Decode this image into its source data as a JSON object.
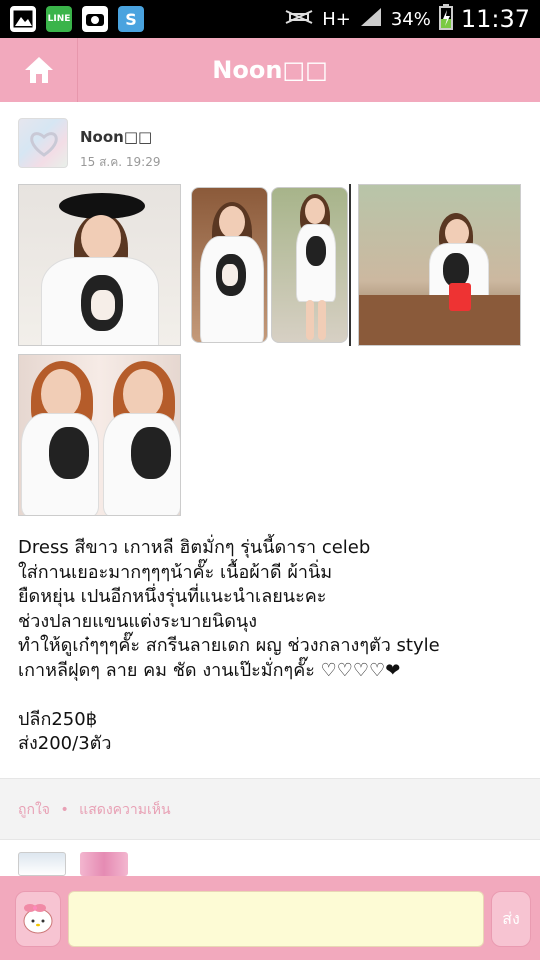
{
  "status_bar": {
    "icons": [
      "gallery-icon",
      "line-icon",
      "camera-icon",
      "s-app-icon"
    ],
    "line_label": "LINE",
    "s_label": "S",
    "network": "H+",
    "battery": "34%",
    "time": "11:37"
  },
  "header": {
    "title": "Noon□□",
    "home_icon": "home-icon"
  },
  "post": {
    "author": "Noon□□",
    "timestamp": "15 ส.ค. 19:29",
    "caption": "Dress สีขาว เกาหลี ฮิตมั่กๆ รุ่นนี้ดารา celeb\nใส่กานเยอะมากๆๆๆน้าคั๊ะ เนื้อผ้าดี ผ้านิ่ม\nยืดหยุ่น เปนอีกหนึ่งรุ่นที่แนะนำเลยนะคะ\nช่วงปลายแขนแต่งระบายนิดนุง\nทำให้ดูเก๋ๆๆๆคั๊ะ สกรีนลายเดก ผญ ช่วงกลางๆตัว style\nเกาหลีฝุดๆ ลาย คม ชัด งานเป๊ะมั่กๆคั๊ะ ♡♡♡♡❤\n\nปลีก250฿\nส่ง200/3ตัว"
  },
  "actions": {
    "like": "ถูกใจ",
    "separator": "•",
    "comment": "แสดงความเห็น"
  },
  "input": {
    "placeholder": "",
    "send_label": "ส่ง"
  },
  "colors": {
    "header_pink": "#f2a9bd",
    "action_pink": "#e8a1b5",
    "input_yellow": "#fdfbd5"
  }
}
